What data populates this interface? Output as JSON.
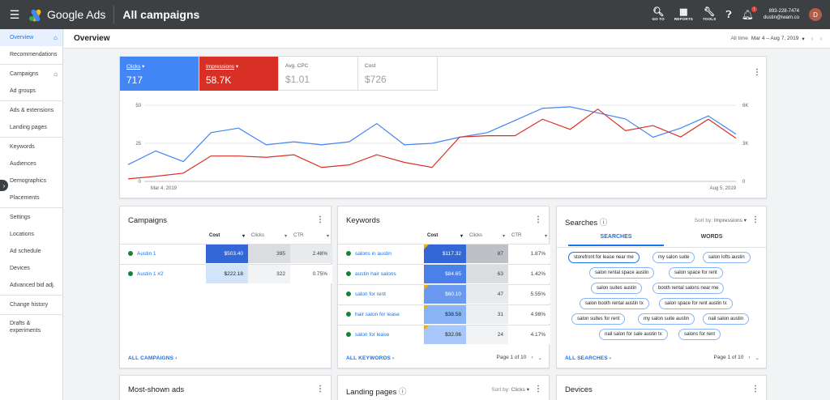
{
  "topbar": {
    "app_name": "Google Ads",
    "page_title": "All campaigns",
    "tools": [
      {
        "label": "GO TO",
        "icon": "search-icon"
      },
      {
        "label": "REPORTS",
        "icon": "reports-icon"
      },
      {
        "label": "TOOLS",
        "icon": "wrench-icon"
      }
    ],
    "notification_count": "!",
    "account_phone": "893-228-7474",
    "account_email": "dustin@iwam.co",
    "avatar_letter": "D"
  },
  "sidebar": {
    "items": [
      {
        "label": "Overview",
        "active": true,
        "home": true
      },
      {
        "label": "Recommendations"
      },
      {
        "sep": true
      },
      {
        "label": "Campaigns",
        "home": true
      },
      {
        "label": "Ad groups"
      },
      {
        "sep": true
      },
      {
        "label": "Ads & extensions"
      },
      {
        "label": "Landing pages"
      },
      {
        "sep": true
      },
      {
        "label": "Keywords"
      },
      {
        "label": "Audiences"
      },
      {
        "label": "Demographics"
      },
      {
        "label": "Placements"
      },
      {
        "sep": true
      },
      {
        "label": "Settings"
      },
      {
        "label": "Locations"
      },
      {
        "label": "Ad schedule"
      },
      {
        "label": "Devices"
      },
      {
        "label": "Advanced bid adj."
      },
      {
        "sep": true
      },
      {
        "label": "Change history"
      },
      {
        "sep": true
      },
      {
        "label": "Drafts & experiments"
      }
    ]
  },
  "overview": {
    "title": "Overview",
    "date_label": "All time",
    "date_range": "Mar 4 – Aug 7, 2019"
  },
  "metrics": [
    {
      "label": "Clicks",
      "value": "717"
    },
    {
      "label": "Impressions",
      "value": "58.7K"
    },
    {
      "label": "Avg. CPC",
      "value": "$1.01"
    },
    {
      "label": "Cost",
      "value": "$726"
    }
  ],
  "chart_data": {
    "type": "line",
    "x_start_label": "Mar 4, 2019",
    "x_end_label": "Aug 5, 2019",
    "left_axis": {
      "ticks": [
        "50",
        "25",
        "0"
      ],
      "range": [
        0,
        50
      ]
    },
    "right_axis": {
      "ticks": [
        "6K",
        "3K",
        "0"
      ],
      "range": [
        0,
        6000
      ]
    },
    "colors": {
      "clicks": "#4285f4",
      "impressions": "#d93025"
    },
    "series": [
      {
        "values": [
          11,
          20,
          13,
          32,
          35,
          24,
          26,
          24,
          26,
          38,
          24,
          25,
          29,
          32,
          40,
          48,
          49,
          45,
          41,
          29,
          35,
          43,
          31
        ]
      },
      {
        "values": [
          200,
          400,
          650,
          2000,
          2000,
          1900,
          2100,
          1100,
          1300,
          2100,
          1500,
          1100,
          3500,
          3600,
          3600,
          4900,
          4100,
          5700,
          4000,
          4400,
          3500,
          4900,
          3400
        ]
      }
    ]
  },
  "campaigns": {
    "title": "Campaigns",
    "headers": [
      "Cost",
      "Clicks",
      "CTR"
    ],
    "rows": [
      {
        "name": "Austin 1",
        "cost": "$503.40",
        "clicks": "395",
        "ctr": "2.48%"
      },
      {
        "name": "Austin 1 #2",
        "cost": "$222.18",
        "clicks": "322",
        "ctr": "0.75%"
      }
    ],
    "footer": "ALL CAMPAIGNS"
  },
  "keywords": {
    "title": "Keywords",
    "headers": [
      "Cost",
      "Clicks",
      "CTR"
    ],
    "rows": [
      {
        "name": "salons in austin",
        "cost": "$117.32",
        "clicks": "87",
        "ctr": "1.87%"
      },
      {
        "name": "austin hair salons",
        "cost": "$84.65",
        "clicks": "63",
        "ctr": "1.42%"
      },
      {
        "name": "salon for rent",
        "cost": "$60.10",
        "clicks": "47",
        "ctr": "5.55%"
      },
      {
        "name": "hair salon for lease",
        "cost": "$38.58",
        "clicks": "31",
        "ctr": "4.98%"
      },
      {
        "name": "salon for lease",
        "cost": "$32.06",
        "clicks": "24",
        "ctr": "4.17%"
      }
    ],
    "footer": "ALL KEYWORDS",
    "pager": "Page 1 of 10"
  },
  "searches": {
    "title": "Searches",
    "sort_label": "Sort by:",
    "sort_value": "Impressions",
    "tabs": [
      "SEARCHES",
      "WORDS"
    ],
    "chips": [
      "storefront for lease near me",
      "my salon suite",
      "salon lofts austin",
      "salon rental space austin",
      "salon space for rent",
      "salon suites austin",
      "booth rental salons near me",
      "salon booth rental austin tx",
      "salon space for rent austin tx",
      "salon suites for rent",
      "my salon suite austin",
      "nail salon austin",
      "nail salon for sale austin tx",
      "salons for rent"
    ],
    "footer": "ALL SEARCHES",
    "pager": "Page 1 of 10"
  },
  "bottom_cards": {
    "most_shown_ads": "Most-shown ads",
    "landing_pages": "Landing pages",
    "landing_sort_label": "Sort by:",
    "landing_sort_value": "Clicks",
    "devices": "Devices"
  }
}
